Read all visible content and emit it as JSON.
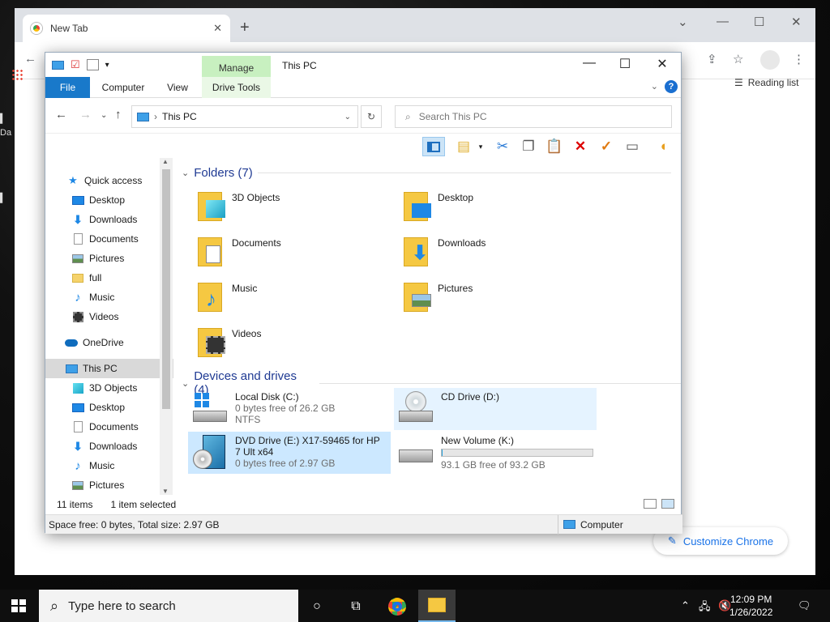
{
  "browser": {
    "tab_title": "New Tab",
    "new_tab_label": "+",
    "reading_list": "Reading list",
    "customize_label": "Customize Chrome"
  },
  "explorer": {
    "title": "This PC",
    "manage_tab": "Manage",
    "ribbon_tabs": [
      "File",
      "Computer",
      "View",
      "Drive Tools"
    ],
    "address": "This PC",
    "search_placeholder": "Search This PC",
    "nav": {
      "quick_access": "Quick access",
      "quick_items": [
        {
          "label": "Desktop",
          "icon": "desktop-icon"
        },
        {
          "label": "Downloads",
          "icon": "downloads-icon"
        },
        {
          "label": "Documents",
          "icon": "documents-icon"
        },
        {
          "label": "Pictures",
          "icon": "pictures-icon"
        },
        {
          "label": "full",
          "icon": "folder-icon"
        },
        {
          "label": "Music",
          "icon": "music-icon"
        },
        {
          "label": "Videos",
          "icon": "videos-icon"
        }
      ],
      "onedrive": "OneDrive",
      "this_pc": "This PC",
      "pc_items": [
        {
          "label": "3D Objects",
          "icon": "cube-icon"
        },
        {
          "label": "Desktop",
          "icon": "desktop-icon"
        },
        {
          "label": "Documents",
          "icon": "documents-icon"
        },
        {
          "label": "Downloads",
          "icon": "downloads-icon"
        },
        {
          "label": "Music",
          "icon": "music-icon"
        },
        {
          "label": "Pictures",
          "icon": "pictures-icon"
        }
      ]
    },
    "folders_header": "Folders (7)",
    "folders": [
      "3D Objects",
      "Desktop",
      "Documents",
      "Downloads",
      "Music",
      "Pictures",
      "Videos"
    ],
    "drives_header": "Devices and drives (4)",
    "drives": [
      {
        "name": "Local Disk (C:)",
        "free": "0 bytes free of 26.2 GB",
        "fs": "NTFS"
      },
      {
        "name": "CD Drive (D:)"
      },
      {
        "name": "DVD Drive (E:) X17-59465 for HP 7 Ult x64",
        "free": "0 bytes free of 2.97 GB"
      },
      {
        "name": "New Volume (K:)",
        "free": "93.1 GB free of 93.2 GB",
        "used_fraction": 0.001
      }
    ],
    "status_items": "11 items",
    "status_selected": "1 item selected",
    "info_left": "Space free: 0 bytes, Total size: 2.97 GB",
    "info_right": "Computer"
  },
  "taskbar": {
    "search_placeholder": "Type here to search",
    "time": "12:09 PM",
    "date": "1/26/2022"
  },
  "colors": {
    "accent": "#1979ca",
    "manage": "#c8f0c0",
    "selection": "#cce8ff"
  }
}
